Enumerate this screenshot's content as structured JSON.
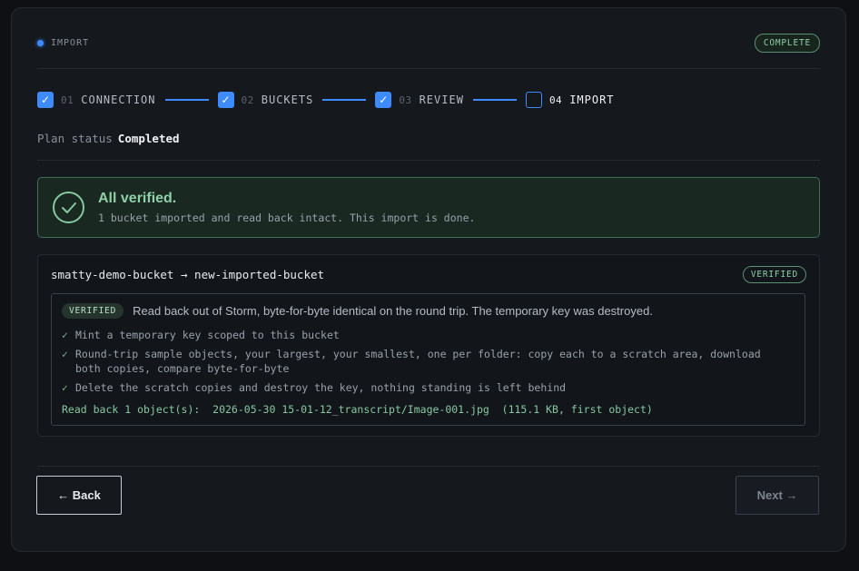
{
  "header": {
    "title": "IMPORT",
    "status_badge": "COMPLETE",
    "accent_color": "#3d8bfd",
    "success_color": "#8fd0a8"
  },
  "stepper": {
    "steps": [
      {
        "num": "01",
        "label": "CONNECTION",
        "checked": true
      },
      {
        "num": "02",
        "label": "BUCKETS",
        "checked": true
      },
      {
        "num": "03",
        "label": "REVIEW",
        "checked": true
      },
      {
        "num": "04",
        "label": "IMPORT",
        "checked": false,
        "active": true
      }
    ],
    "check_glyph": "✓"
  },
  "plan_status": {
    "label": "Plan status",
    "value": "Completed"
  },
  "banner": {
    "icon": "check-circle-icon",
    "title": "All verified.",
    "subtitle": "1 bucket imported and read back intact. This import is done."
  },
  "bucket": {
    "title": "smatty-demo-bucket → new-imported-bucket",
    "badge": "VERIFIED",
    "detail": {
      "pill": "VERIFIED",
      "summary": "Read back out of Storm, byte-for-byte identical on the round trip. The temporary key was destroyed.",
      "tick_glyph": "✓",
      "steps": [
        "Mint a temporary key scoped to this bucket",
        "Round-trip sample objects, your largest, your smallest, one per folder: copy each to a scratch area, download both copies, compare byte-for-byte",
        "Delete the scratch copies and destroy the key, nothing standing is left behind"
      ],
      "readback": "Read back 1 object(s):  2026-05-30 15-01-12_transcript/Image-001.jpg  (115.1 KB, first object)"
    }
  },
  "footer": {
    "back_label": "← Back",
    "next_label": "Next →"
  }
}
